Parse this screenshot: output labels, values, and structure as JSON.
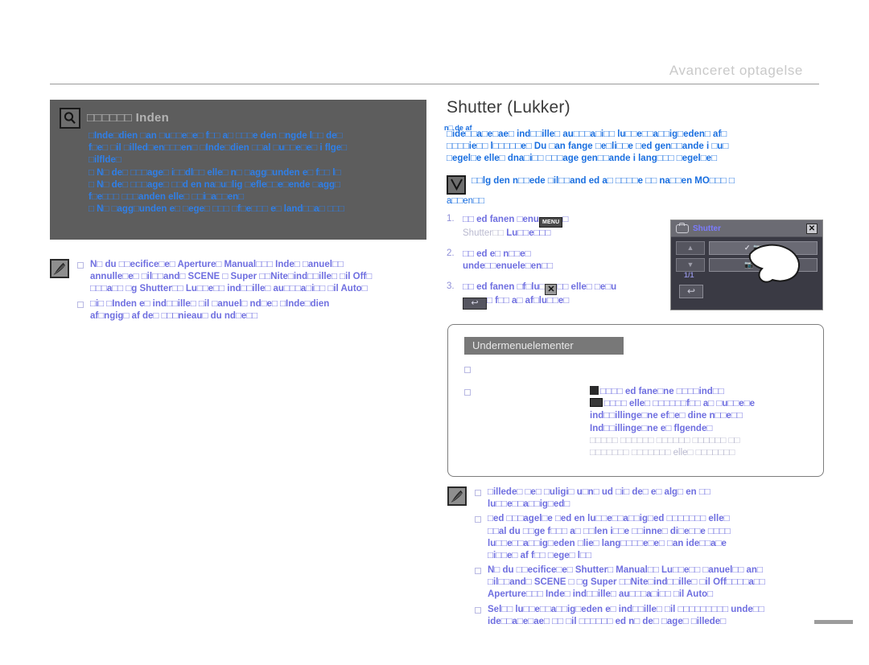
{
  "header": {
    "title": "Avanceret optagelse"
  },
  "tip_box": {
    "icon": "magnifier-icon",
    "title_prefix": "□□□□□□",
    "title": "Inden",
    "lines": [
      "□Inde□dien □an □u□□e□e□ f□□ a□ □□□e den □ngde l□□ de□",
      "f□e□ □il □illed□en□□□en□ □Inde□dien □□al □u□□e□e□ i flge□",
      "□ilflde□",
      "□ N□ de□ □□□age□ i□□dl□□ elle□ n□ □agg□unden e□ f□□ l□",
      "□ N□ de□ □□□age□ □□d en na□u□lig □efle□□e□ende □agg□",
      "   f□e□□□ □□□anden elle□ □□i□a□□en□",
      "□ N□ □agg□unden e□ □ege□ □□□ □f□e□□□ e□ land□□a□ □□□"
    ]
  },
  "note_left": {
    "icon": "pencil-note-icon",
    "items": [
      {
        "lines": [
          "N□ du □□ecifice□e□ Aperture□ Manual□□□ Inde□ □anuel□□",
          "annulle□e□ □il□□and□ SCENE □ Super □□Nite□ind□□ille□ □il Off□",
          "□□□a□□ □g Shutter□□ Lu□□e□□ ind□□ille□ au□□□a□i□□ □il Auto□"
        ]
      },
      {
        "lines": [
          "□i□ □Inden e□ ind□□ille□ □il □anuel□ nd□e□ □Inde□dien",
          "af□ngig□ af de□ □□□nieau□ du nd□e□□"
        ]
      }
    ]
  },
  "section": {
    "title": "Shutter (Lukker)",
    "overlay_fragment": "n□\nde\naf",
    "intro_lines": [
      "□ide□□a□e□ae□ ind□□ille□ au□□□a□i□□ lu□□e□□a□□ig□eden□ af□",
      "□□□□ie□□ l□□□□□e□ Du □an fange □e□li□□e □ed gen□□ande i □u□",
      "□egel□e elle□ dna□i□□ □□□age gen□□ande i lang□□□ □egel□e□"
    ],
    "v_icon": "v-checkmark-icon",
    "v_line": "□□lg den n□□ede □il□□and ed a□ □□□□e □□ na□□en MO□□□ □",
    "v_line2": "a□□en□□"
  },
  "steps": [
    {
      "num": "1.",
      "pre": "□□ ed fanen □enu",
      "kbd": "MENU",
      "post": "□",
      "line2_faint": "Shutter□□",
      "line2_bold": "Lu□□e□□□"
    },
    {
      "num": "2.",
      "pre": "□□ ed e□ n□□e□",
      "line2_bold": "unde□□enuele□en□□"
    },
    {
      "num": "3.",
      "pre": "□□ ed fanen □f□lu□",
      "kbd": "✕",
      "post": "□□ elle□ □e□u",
      "line2_kbd": "↩",
      "line2_bold": "□ f□□ a□ af□lu□□e□"
    }
  ],
  "device": {
    "title": "Shutter",
    "cam_icon": "camcorder-icon",
    "close_icon": "close-icon",
    "up_icon": "▲",
    "down_icon": "▼",
    "items": [
      {
        "check": "✓",
        "label": "Auto",
        "selected": true
      },
      {
        "check": "",
        "label": "Manual",
        "selected": false
      }
    ],
    "page_indicator": "1/1",
    "back_icon": "↩",
    "hand_icon": "hand-pointer-icon"
  },
  "submenu": {
    "tab_label": "Undermenuelementer",
    "rows": [
      {
        "bullet": "□",
        "text": ""
      },
      {
        "bullet": "□",
        "lines": [
          "□□□□ ed fane□ne □□□□ind□□",
          "□□□□ elle□ □□□□□□f□□ a□ □u□□e□e",
          "ind□□illinge□ne ef□e□ dine n□□e□□",
          "Ind□□illinge□ne e□ flgende□",
          "□□□□□ □□□□□□ □□□□□□ □□□□□□ □□",
          "□□□□□□□ □□□□□□□ elle□ □□□□□□□"
        ]
      }
    ]
  },
  "note_bottom": {
    "icon": "pencil-note-icon",
    "items": [
      {
        "lines": [
          "□illede□ □e□ □uligi□ u□n□ ud □i□ de□ e□ alg□ en □□",
          "lu□□e□□a□□ig□ed□"
        ]
      },
      {
        "lines": [
          "□ed □□□agel□e □ed en lu□□e□□a□□ig□ed □□□□□□□ elle□",
          "□□al du □□ge f□□□ a□ □□len i□□e □□inne□ di□e□□e □□□□",
          "lu□□e□□a□□ig□eden □lie□ lang□□□□e□e□ □an ide□□a□e",
          "□i□□e□ af f□□ □ege□ l□□"
        ]
      },
      {
        "lines": [
          "N□ du □□ecifice□e□ Shutter□ Manual□□ Lu□□e□□ □anuel□□ an□",
          "□il□□and□ SCENE □ □g Super □□Nite□ind□□ille□ □il Off□□□□a□□",
          "Aperture□□□ Inde□ ind□□ille□ au□□□a□i□□ □il Auto□"
        ]
      },
      {
        "lines": [
          "Sel□□ lu□□e□□a□□ig□eden e□ ind□□ille□ □il □□□□□□□□□ unde□□",
          "ide□□a□e□ae□ □□ □il □□□□□□ ed n□ de□ □age□ □illede□"
        ]
      }
    ]
  },
  "colors": {
    "accent_blue": "#1a6fe0",
    "note_violet": "#6f6fe0",
    "tip_bg": "#5d5d5d",
    "header_gray": "#c9c9c9"
  }
}
